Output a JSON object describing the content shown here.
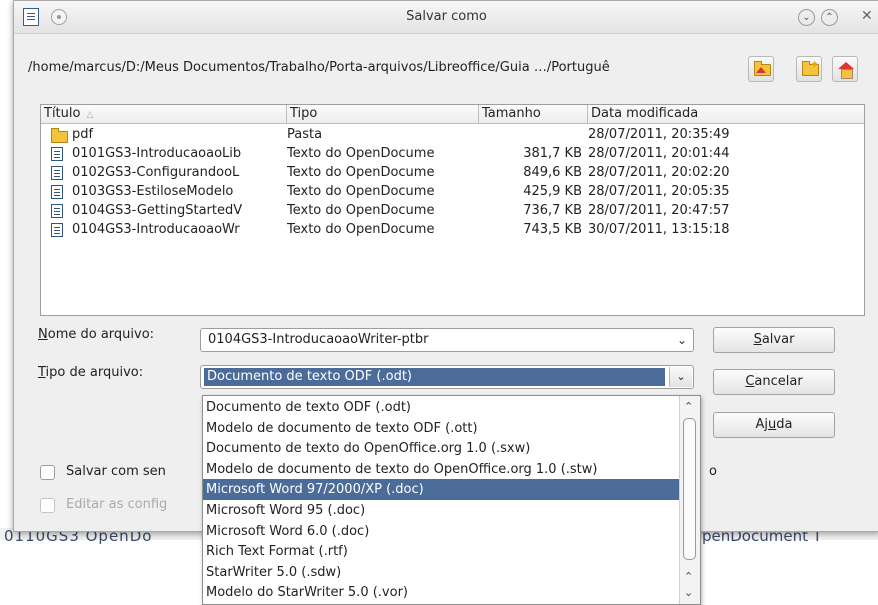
{
  "window": {
    "title": "Salvar como"
  },
  "path": "/home/marcus/D:/Meus Documentos/Trabalho/Porta-arquivos/Libreoffice/Guia …/Portuguê",
  "columns": {
    "title": "Título",
    "type": "Tipo",
    "size": "Tamanho",
    "date": "Data modificada"
  },
  "files": [
    {
      "icon": "folder-icon",
      "name": "pdf",
      "type": "Pasta",
      "size": "",
      "date": "28/07/2011, 20:35:49"
    },
    {
      "icon": "document-icon",
      "name": "0101GS3-IntroducaoaoLib",
      "type": "Texto do OpenDocume",
      "size": "381,7 KB",
      "date": "28/07/2011, 20:01:44"
    },
    {
      "icon": "document-icon",
      "name": "0102GS3-ConfigurandooL",
      "type": "Texto do OpenDocume",
      "size": "849,6 KB",
      "date": "28/07/2011, 20:02:20"
    },
    {
      "icon": "document-icon",
      "name": "0103GS3-EstiloseModelo",
      "type": "Texto do OpenDocume",
      "size": "425,9 KB",
      "date": "28/07/2011, 20:05:35"
    },
    {
      "icon": "document-icon",
      "name": "0104GS3-GettingStartedV",
      "type": "Texto do OpenDocume",
      "size": "736,7 KB",
      "date": "28/07/2011, 20:47:57"
    },
    {
      "icon": "document-icon",
      "name": "0104GS3-IntroducaoaoWr",
      "type": "Texto do OpenDocume",
      "size": "743,5 KB",
      "date": "30/07/2011, 13:15:18"
    }
  ],
  "filename": {
    "label": "Nome do arquivo:",
    "value": "0104GS3-IntroducaoaoWriter-ptbr"
  },
  "filetype": {
    "label": "Tipo de arquivo:",
    "value": "Documento de texto ODF (.odt)"
  },
  "buttons": {
    "save": "Salvar",
    "cancel": "Cancelar",
    "help": "Ajuda"
  },
  "checkboxes": {
    "password": "Salvar com sen",
    "password_tail": "o",
    "filter": "Editar as config"
  },
  "dropdown_options": [
    "Documento de texto ODF (.odt)",
    "Modelo de documento de texto ODF (.ott)",
    "Documento de texto do OpenOffice.org 1.0 (.sxw)",
    "Modelo de documento de texto do OpenOffice.org 1.0 (.stw)",
    "Microsoft Word 97/2000/XP (.doc)",
    "Microsoft Word 95 (.doc)",
    "Microsoft Word 6.0 (.doc)",
    "Rich Text Format (.rtf)",
    "StarWriter 5.0 (.sdw)",
    "Modelo do StarWriter 5.0 (.vor)"
  ],
  "dropdown_highlighted": "Microsoft Word 97/2000/XP (.doc)",
  "background_text": {
    "left": "0110GS3 OpenDo",
    "right": "penDocument T"
  },
  "colors": {
    "selection": "#4b6c99",
    "folder": "#f2c33b"
  }
}
